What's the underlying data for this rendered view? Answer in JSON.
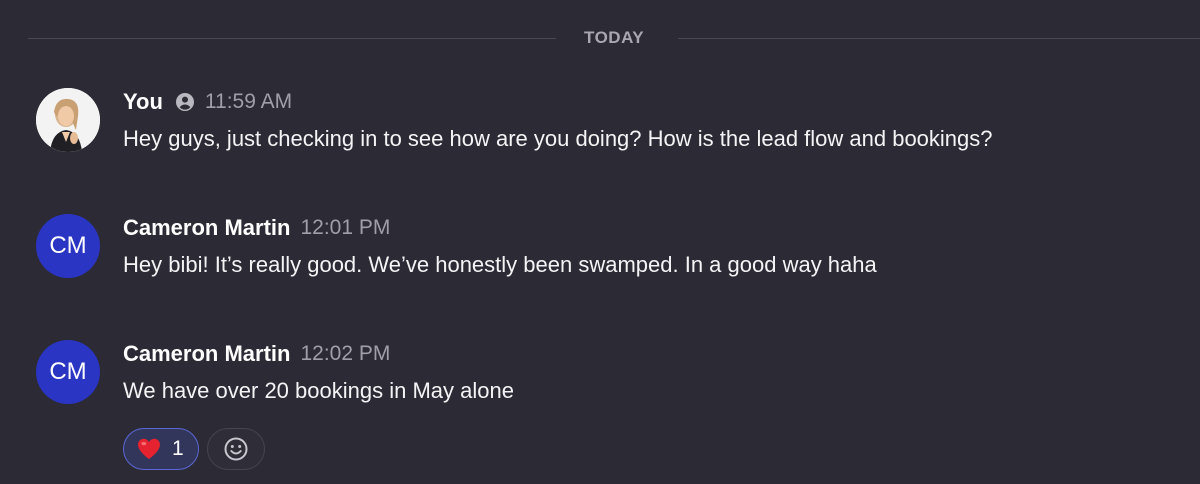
{
  "divider": {
    "label": "TODAY"
  },
  "messages": [
    {
      "author": "You",
      "time": "11:59 AM",
      "text": "Hey guys, just checking in to see how are you doing? How is the lead flow and bookings?",
      "avatar_type": "photo",
      "status_icon": "person-circle-icon"
    },
    {
      "author": "Cameron Martin",
      "time": "12:01 PM",
      "text": "Hey bibi! It’s really good. We’ve honestly been swamped. In a good way haha",
      "avatar_type": "initials",
      "initials": "CM"
    },
    {
      "author": "Cameron Martin",
      "time": "12:02 PM",
      "text": "We have over 20 bookings in May alone",
      "avatar_type": "initials",
      "initials": "CM",
      "reactions": [
        {
          "emoji": "heart-icon",
          "count": "1",
          "active": true
        }
      ],
      "add_reaction_icon": "smiley-add-reaction-icon"
    }
  ],
  "colors": {
    "background": "#2c2a34",
    "avatar_blue": "#2b35c4",
    "reaction_border": "#5b67d6",
    "timestamp": "#a09ea8",
    "heart": "#e5222f"
  }
}
